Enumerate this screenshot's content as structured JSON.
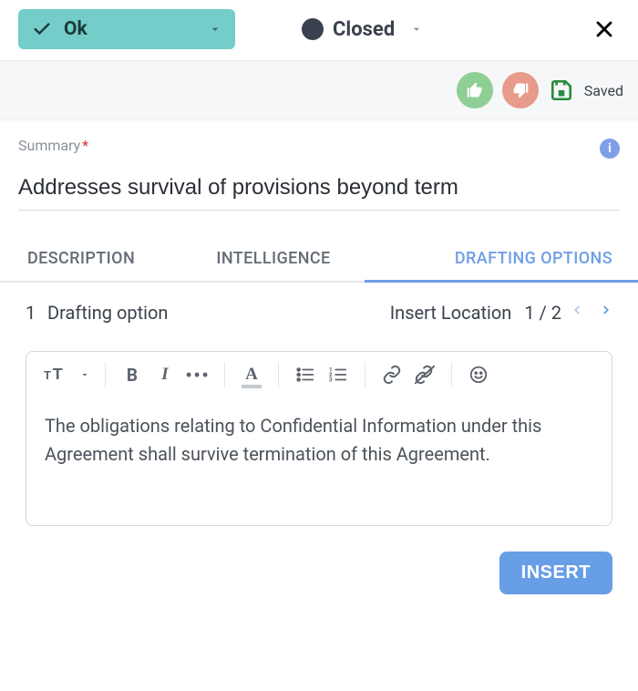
{
  "header": {
    "status_pill": {
      "label": "Ok"
    },
    "closed": {
      "label": "Closed"
    },
    "saved_label": "Saved"
  },
  "summary": {
    "label": "Summary",
    "required_mark": "*",
    "value": "Addresses survival of provisions beyond term"
  },
  "tabs": {
    "description": "DESCRIPTION",
    "intelligence": "INTELLIGENCE",
    "drafting": "DRAFTING OPTIONS"
  },
  "drafting": {
    "count": "1",
    "count_label": "Drafting option",
    "insert_location_label": "Insert Location",
    "location_current": "1",
    "location_sep": " / ",
    "location_total": "2",
    "editor_text": "The obligations relating to Confidential Information under this Agreement shall survive termination of this Agreement.",
    "insert_button": "INSERT"
  }
}
